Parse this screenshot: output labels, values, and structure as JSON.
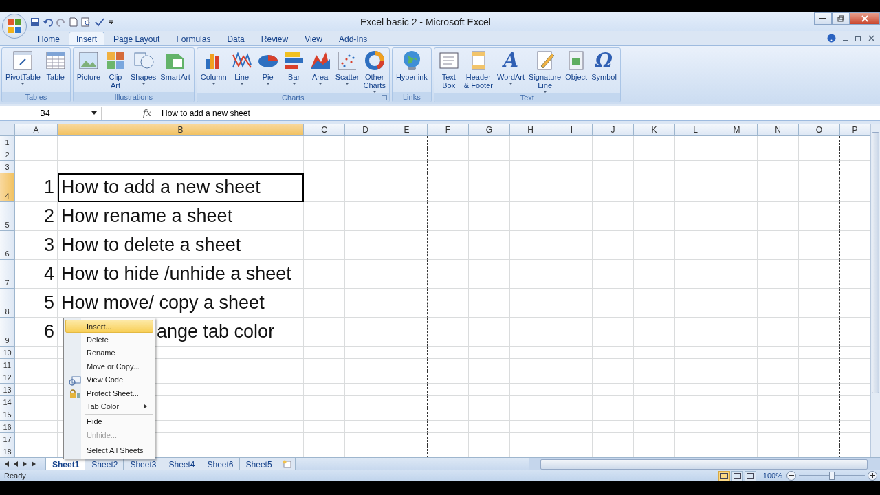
{
  "window": {
    "title": "Excel basic 2 - Microsoft Excel"
  },
  "ribbon_tabs": [
    {
      "label": "Home",
      "selected": false
    },
    {
      "label": "Insert",
      "selected": true
    },
    {
      "label": "Page Layout",
      "selected": false
    },
    {
      "label": "Formulas",
      "selected": false
    },
    {
      "label": "Data",
      "selected": false
    },
    {
      "label": "Review",
      "selected": false
    },
    {
      "label": "View",
      "selected": false
    },
    {
      "label": "Add-Ins",
      "selected": false
    }
  ],
  "ribbon_groups": [
    {
      "label": "Tables",
      "buttons": [
        {
          "lines": [
            "PivotTable"
          ],
          "menu": true
        },
        {
          "lines": [
            "Table"
          ],
          "menu": false
        }
      ]
    },
    {
      "label": "Illustrations",
      "buttons": [
        {
          "lines": [
            "Picture"
          ],
          "menu": false
        },
        {
          "lines": [
            "Clip",
            "Art"
          ],
          "menu": false
        },
        {
          "lines": [
            "Shapes"
          ],
          "menu": true
        },
        {
          "lines": [
            "SmartArt"
          ],
          "menu": false
        }
      ]
    },
    {
      "label": "Charts",
      "launcher": true,
      "buttons": [
        {
          "lines": [
            "Column"
          ],
          "menu": true
        },
        {
          "lines": [
            "Line"
          ],
          "menu": true
        },
        {
          "lines": [
            "Pie"
          ],
          "menu": true
        },
        {
          "lines": [
            "Bar"
          ],
          "menu": true
        },
        {
          "lines": [
            "Area"
          ],
          "menu": true
        },
        {
          "lines": [
            "Scatter"
          ],
          "menu": true
        },
        {
          "lines": [
            "Other",
            "Charts"
          ],
          "menu": true
        }
      ]
    },
    {
      "label": "Links",
      "buttons": [
        {
          "lines": [
            "Hyperlink"
          ],
          "menu": false
        }
      ]
    },
    {
      "label": "Text",
      "buttons": [
        {
          "lines": [
            "Text",
            "Box"
          ],
          "menu": false
        },
        {
          "lines": [
            "Header",
            "& Footer"
          ],
          "menu": false
        },
        {
          "lines": [
            "WordArt"
          ],
          "menu": true,
          "glyph": "A"
        },
        {
          "lines": [
            "Signature",
            "Line"
          ],
          "menu": true
        },
        {
          "lines": [
            "Object"
          ],
          "menu": false
        },
        {
          "lines": [
            "Symbol"
          ],
          "menu": false,
          "glyph": "Ω"
        }
      ]
    }
  ],
  "name_box": "B4",
  "function_label": "fx",
  "formula": "How to add a new sheet",
  "columns": [
    {
      "label": "A",
      "selected": false
    },
    {
      "label": "B",
      "selected": true
    },
    {
      "label": "C",
      "selected": false
    },
    {
      "label": "D",
      "selected": false
    },
    {
      "label": "E",
      "selected": false
    },
    {
      "label": "F",
      "selected": false
    },
    {
      "label": "G",
      "selected": false
    },
    {
      "label": "H",
      "selected": false
    },
    {
      "label": "I",
      "selected": false
    },
    {
      "label": "J",
      "selected": false
    },
    {
      "label": "K",
      "selected": false
    },
    {
      "label": "L",
      "selected": false
    },
    {
      "label": "M",
      "selected": false
    },
    {
      "label": "N",
      "selected": false
    },
    {
      "label": "O",
      "selected": false
    },
    {
      "label": "P",
      "selected": false
    }
  ],
  "rows": [
    {
      "number": "1",
      "selected": false
    },
    {
      "number": "2",
      "selected": false
    },
    {
      "number": "3",
      "selected": false
    },
    {
      "number": "4",
      "selected": true,
      "a": "1",
      "b": "How to add a new sheet"
    },
    {
      "number": "5",
      "selected": false,
      "a": "2",
      "b": "How rename a sheet"
    },
    {
      "number": "6",
      "selected": false,
      "a": "3",
      "b": "How to delete a sheet"
    },
    {
      "number": "7",
      "selected": false,
      "a": "4",
      "b": "How to hide /unhide a sheet"
    },
    {
      "number": "8",
      "selected": false,
      "a": "5",
      "b": "How move/ copy a sheet"
    },
    {
      "number": "9",
      "selected": false,
      "a": "6",
      "b": "ange tab color",
      "covered": true
    },
    {
      "number": "10",
      "selected": false
    },
    {
      "number": "11",
      "selected": false
    },
    {
      "number": "12",
      "selected": false
    },
    {
      "number": "13",
      "selected": false
    },
    {
      "number": "14",
      "selected": false
    },
    {
      "number": "15",
      "selected": false
    },
    {
      "number": "16",
      "selected": false
    },
    {
      "number": "17",
      "selected": false
    },
    {
      "number": "18",
      "selected": false
    }
  ],
  "context_menu": [
    {
      "kind": "item",
      "label": "Insert...",
      "selected": true,
      "disabled": false
    },
    {
      "kind": "item",
      "label": "Delete",
      "selected": false,
      "disabled": false
    },
    {
      "kind": "item",
      "label": "Rename",
      "selected": false,
      "disabled": false
    },
    {
      "kind": "item",
      "label": "Move or Copy...",
      "selected": false,
      "disabled": false
    },
    {
      "kind": "item",
      "label": "View Code",
      "selected": false,
      "disabled": false
    },
    {
      "kind": "item",
      "label": "Protect Sheet...",
      "selected": false,
      "disabled": false
    },
    {
      "kind": "item",
      "label": "Tab Color",
      "selected": false,
      "disabled": false,
      "submenu": true
    },
    {
      "kind": "separator"
    },
    {
      "kind": "item",
      "label": "Hide",
      "selected": false,
      "disabled": false
    },
    {
      "kind": "item",
      "label": "Unhide...",
      "selected": false,
      "disabled": true
    },
    {
      "kind": "separator"
    },
    {
      "kind": "item",
      "label": "Select All Sheets",
      "selected": false,
      "disabled": false
    }
  ],
  "sheet_tabs": [
    {
      "label": "Sheet1",
      "selected": true
    },
    {
      "label": "Sheet2",
      "selected": false
    },
    {
      "label": "Sheet3",
      "selected": false
    },
    {
      "label": "Sheet4",
      "selected": false
    },
    {
      "label": "Sheet6",
      "selected": false
    },
    {
      "label": "Sheet5",
      "selected": false
    }
  ],
  "status_bar": {
    "text": "Ready",
    "zoom": "100%",
    "zoom_slider": {
      "level": 0.5
    },
    "views": [
      {
        "selected": true
      },
      {
        "selected": false
      },
      {
        "selected": false
      }
    ]
  }
}
